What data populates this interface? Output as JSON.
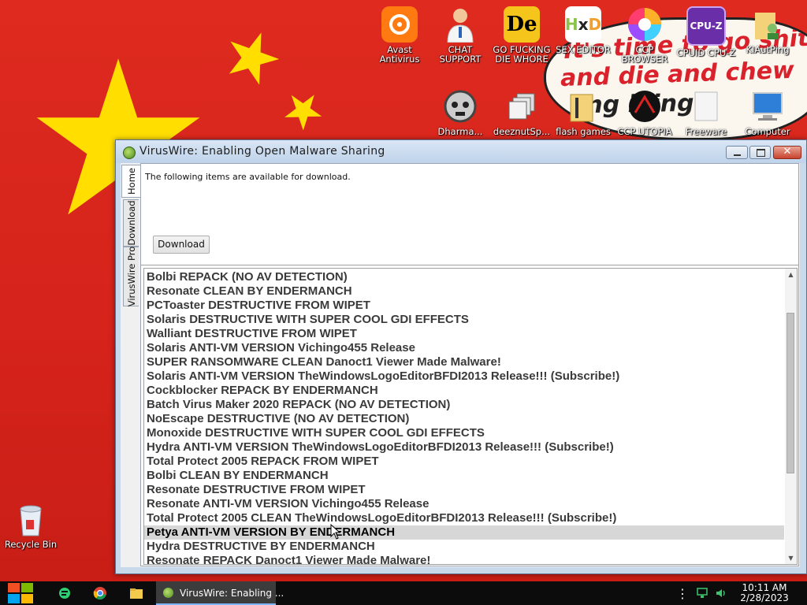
{
  "desktop_icons": [
    {
      "label": "Avast Antivirus",
      "icon": "avast-icon"
    },
    {
      "label": "CHAT SUPPORT",
      "icon": "doctor-icon"
    },
    {
      "label": "GO FUCKING DIE WHORE",
      "icon": "de-icon"
    },
    {
      "label": "SEX EDITOR",
      "icon": "hxd-icon"
    },
    {
      "label": "CCP BROWSER",
      "icon": "browser-icon"
    },
    {
      "label": "CPUID CPU-Z",
      "icon": "cpuz-icon"
    },
    {
      "label": "KIAutPing",
      "icon": "folder-user-icon"
    },
    {
      "label": "Dharma...",
      "icon": "skull-icon"
    },
    {
      "label": "deeznutSp...",
      "icon": "stack-icon"
    },
    {
      "label": "flash games",
      "icon": "folder-icon"
    },
    {
      "label": "CCP UTOPIA",
      "icon": "utopia-icon"
    },
    {
      "label": "Freeware",
      "icon": "file-icon"
    },
    {
      "label": "Computer",
      "icon": "computer-icon"
    },
    {
      "label": "Recycle Bin",
      "icon": "recycle-bin-icon"
    }
  ],
  "wallpaper_text": [
    "It's time to go shit",
    "and die and chew",
    "ing illing"
  ],
  "window": {
    "title": "VirusWire: Enabling Open Malware Sharing",
    "close_glyph": "✕",
    "tabs": [
      "Home",
      "Download",
      "VirusWire Pro"
    ],
    "message": "The following items are available for download.",
    "download_label": "Download",
    "items": [
      "Bolbi REPACK (NO AV DETECTION)",
      "Resonate CLEAN BY ENDERMANCH",
      "PCToaster DESTRUCTIVE FROM WIPET",
      "Solaris DESTRUCTIVE WITH SUPER COOL GDI EFFECTS",
      "Walliant DESTRUCTIVE FROM WIPET",
      "Solaris ANTI-VM VERSION Vichingo455 Release",
      "SUPER RANSOMWARE CLEAN Danoct1 Viewer Made Malware!",
      "Solaris ANTI-VM VERSION TheWindowsLogoEditorBFDI2013 Release!!! (Subscribe!)",
      "Cockblocker REPACK BY ENDERMANCH",
      "Batch Virus Maker 2020 REPACK (NO AV DETECTION)",
      "NoEscape DESTRUCTIVE (NO AV DETECTION)",
      "Monoxide DESTRUCTIVE WITH SUPER COOL GDI EFFECTS",
      "Hydra ANTI-VM VERSION TheWindowsLogoEditorBFDI2013 Release!!! (Subscribe!)",
      "Total Protect 2005 REPACK FROM WIPET",
      "Bolbi CLEAN BY ENDERMANCH",
      "Resonate DESTRUCTIVE FROM WIPET",
      "Resonate ANTI-VM VERSION Vichingo455 Release",
      "Total Protect 2005 CLEAN TheWindowsLogoEditorBFDI2013 Release!!! (Subscribe!)",
      "Petya ANTI-VM VERSION BY ENDERMANCH",
      "Hydra DESTRUCTIVE BY ENDERMANCH",
      "Resonate REPACK Danoct1 Viewer Made Malware!"
    ],
    "selected_index": 18
  },
  "taskbar": {
    "app_label": "VirusWire: Enabling ...",
    "time": "10:11 AM",
    "date": "2/28/2023"
  },
  "colors": {
    "wallpaper_red": "#d7231f",
    "star_yellow": "#ffde00",
    "selection": "#d7d7d7"
  }
}
